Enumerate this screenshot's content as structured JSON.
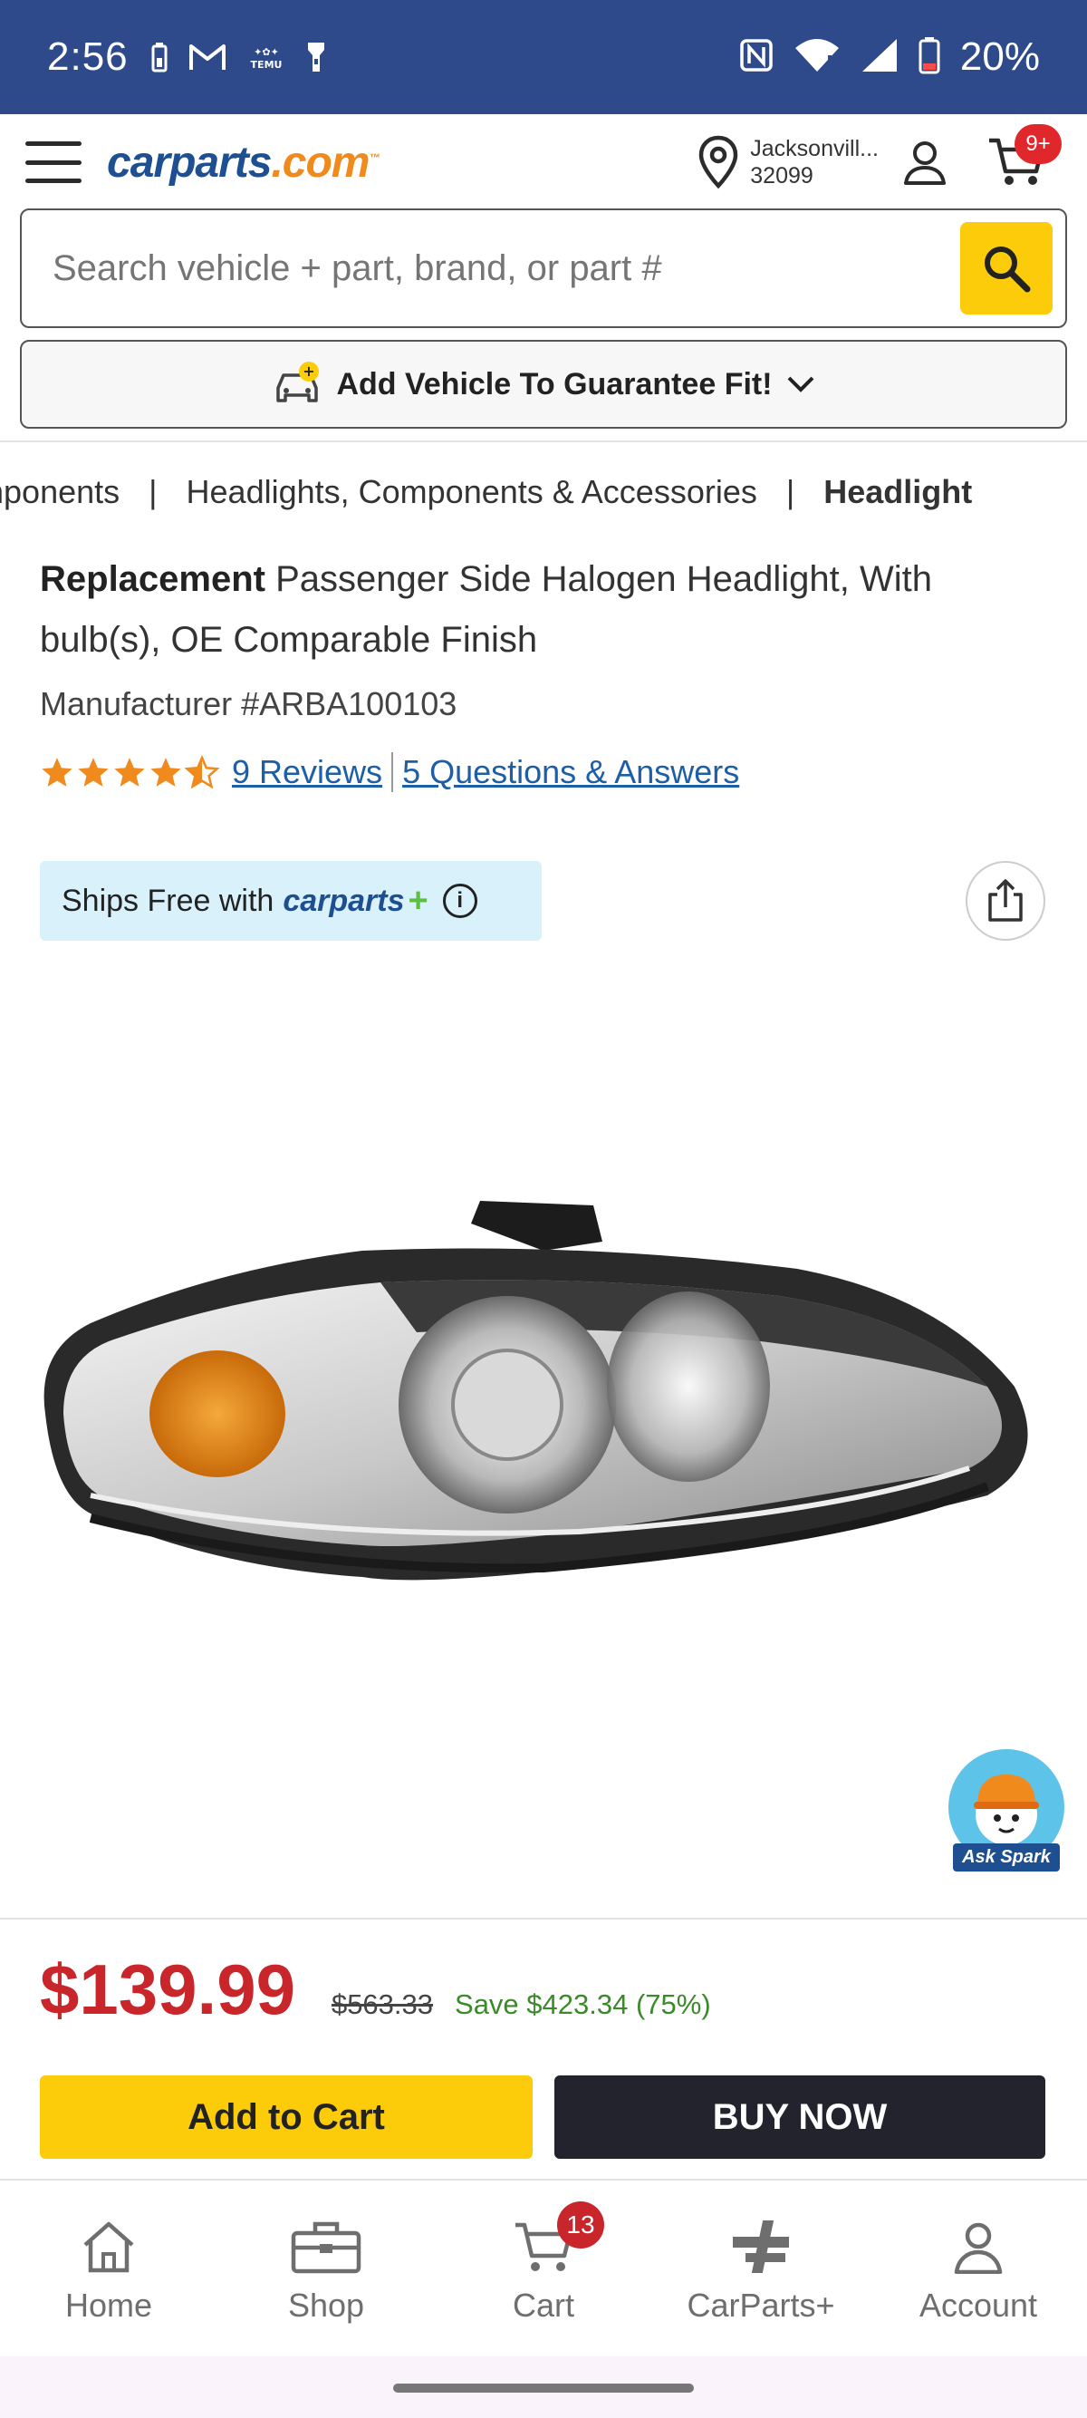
{
  "status_bar": {
    "time": "2:56",
    "battery": "20%",
    "left_icons": [
      "battery-saver-icon",
      "gmail-icon",
      "temu-icon",
      "flashlight-icon"
    ],
    "right_icons": [
      "nfc-icon",
      "wifi-icon",
      "signal-icon",
      "battery-icon"
    ]
  },
  "header": {
    "logo_main": "carparts",
    "logo_suffix": ".com",
    "logo_tm": "™",
    "location_line1": "Jacksonvill...",
    "location_line2": "32099",
    "cart_badge": "9+"
  },
  "search": {
    "placeholder": "Search vehicle + part, brand, or part #"
  },
  "vehicle": {
    "label": "Add Vehicle To Guarantee Fit!",
    "add_badge": "+"
  },
  "breadcrumb": {
    "items": [
      "nponents",
      "Headlights, Components & Accessories",
      "Headlight"
    ],
    "separator": "|"
  },
  "product": {
    "brand": "Replacement",
    "title": " Passenger Side Halogen Headlight, With bulb(s), OE Comparable Finish",
    "manufacturer": "Manufacturer #ARBA100103",
    "rating": 4.5,
    "reviews_link": "9 Reviews",
    "qa_link": "5 Questions & Answers",
    "ships_text": "Ships Free with",
    "ships_brand": "carparts",
    "ships_plus": "+",
    "ships_info": "i"
  },
  "spark": {
    "label": "Ask Spark"
  },
  "pricing": {
    "price": "$139.99",
    "original": "$563.33",
    "savings": "Save $423.34 (75%)"
  },
  "actions": {
    "add_to_cart": "Add to Cart",
    "buy_now": "BUY NOW"
  },
  "bottom_nav": {
    "home": "Home",
    "shop": "Shop",
    "cart": "Cart",
    "cart_badge": "13",
    "carparts_plus": "CarParts+",
    "account": "Account"
  },
  "colors": {
    "status_bar": "#2e4a8a",
    "brand_blue": "#1d4f91",
    "accent_yellow": "#fccc0a",
    "price_red": "#c8262b",
    "save_green": "#3b8a2a",
    "star_orange": "#f08a1c"
  }
}
